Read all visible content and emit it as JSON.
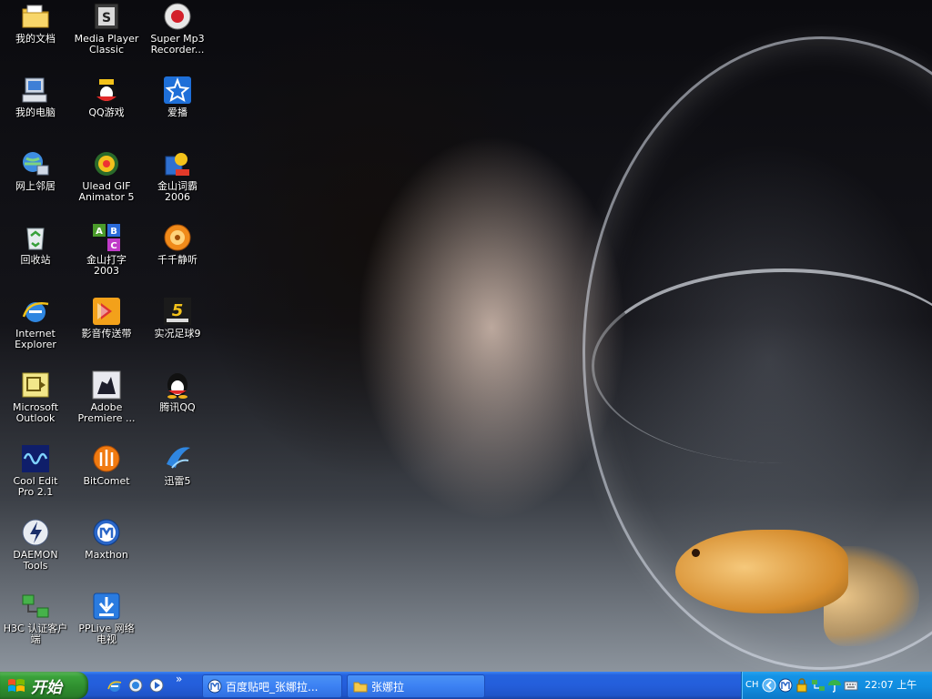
{
  "desktop": {
    "icons": [
      {
        "label": "我的文档",
        "icon": "folder-documents-icon"
      },
      {
        "label": "Media Player\nClassic",
        "icon": "media-player-classic-icon"
      },
      {
        "label": "Super Mp3\nRecorder...",
        "icon": "mp3-recorder-icon"
      },
      {
        "label": "我的电脑",
        "icon": "computer-icon"
      },
      {
        "label": "QQ游戏",
        "icon": "qq-games-icon"
      },
      {
        "label": "爱播",
        "icon": "aibo-icon"
      },
      {
        "label": "网上邻居",
        "icon": "network-icon"
      },
      {
        "label": "Ulead GIF\nAnimator 5",
        "icon": "gif-animator-icon"
      },
      {
        "label": "金山词霸\n2006",
        "icon": "dictionary-icon"
      },
      {
        "label": "回收站",
        "icon": "recycle-bin-icon"
      },
      {
        "label": "金山打字\n2003",
        "icon": "typing-abc-icon"
      },
      {
        "label": "千千静听",
        "icon": "music-player-icon"
      },
      {
        "label": "Internet\nExplorer",
        "icon": "internet-explorer-icon"
      },
      {
        "label": "影音传送带",
        "icon": "video-downloader-icon"
      },
      {
        "label": "实况足球9",
        "icon": "pes-game-icon"
      },
      {
        "label": "Microsoft\nOutlook",
        "icon": "outlook-icon"
      },
      {
        "label": "Adobe\nPremiere ...",
        "icon": "premiere-icon"
      },
      {
        "label": "腾讯QQ",
        "icon": "qq-penguin-icon"
      },
      {
        "label": "Cool Edit\nPro 2.1",
        "icon": "cool-edit-icon"
      },
      {
        "label": "BitComet",
        "icon": "bitcomet-icon"
      },
      {
        "label": "迅雷5",
        "icon": "thunder-icon"
      },
      {
        "label": "DAEMON Tools",
        "icon": "daemon-tools-icon"
      },
      {
        "label": "Maxthon",
        "icon": "maxthon-icon"
      },
      {
        "label": "H3C 认证客户\n端",
        "icon": "h3c-network-icon"
      },
      {
        "label": "PPLive 网络\n电视",
        "icon": "pplive-icon"
      }
    ]
  },
  "taskbar": {
    "start_label": "开始",
    "quick_launch": [
      "internet-explorer-icon",
      "show-desktop-icon",
      "media-player-icon"
    ],
    "chevron": "»",
    "tasks": [
      {
        "label": "百度贴吧_张娜拉...",
        "icon": "maxthon-icon"
      },
      {
        "label": "张娜拉",
        "icon": "folder-icon"
      }
    ],
    "tray": {
      "language": "CH",
      "clock": "22:07 上午"
    }
  },
  "colors": {
    "taskbar_blue": "#245edb",
    "start_green": "#3aa23a",
    "tray_blue": "#118de0"
  }
}
